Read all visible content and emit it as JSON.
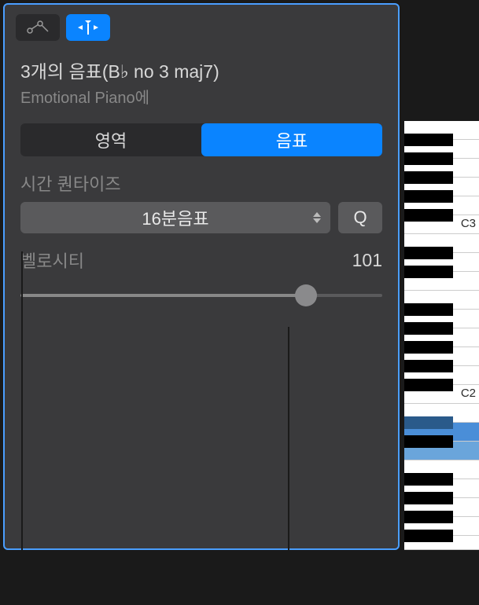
{
  "header": {
    "title": "3개의 음표(B♭ no 3 maj7)",
    "subtitle": "Emotional Piano에"
  },
  "tabs": {
    "region": "영역",
    "note": "음표"
  },
  "quantize": {
    "label": "시간 퀀타이즈",
    "value": "16분음표",
    "button": "Q"
  },
  "velocity": {
    "label": "벨로시티",
    "value": "101",
    "percent": 79
  },
  "keyboard": {
    "labels": {
      "c3": "C3",
      "c2": "C2"
    }
  }
}
